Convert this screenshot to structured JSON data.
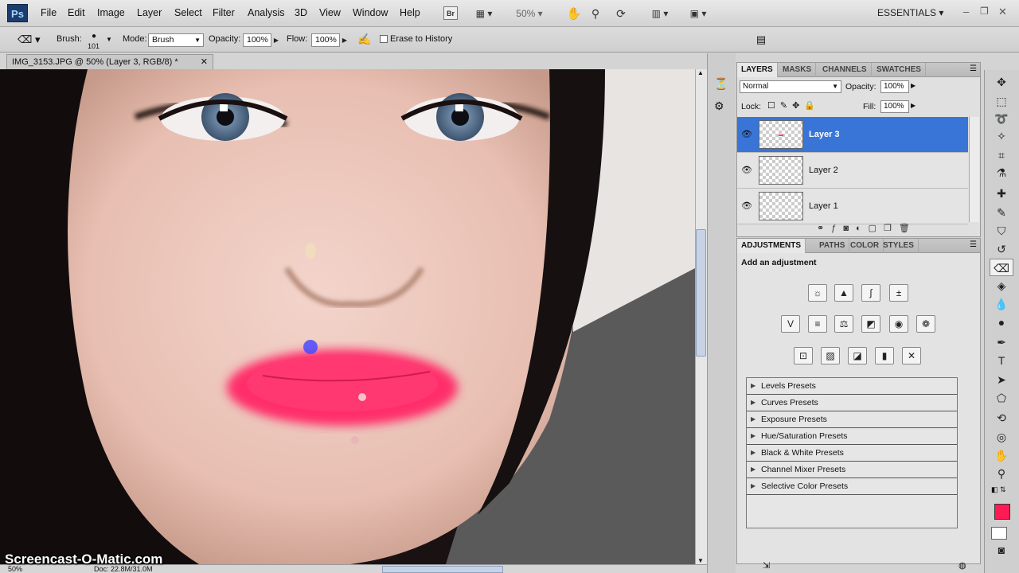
{
  "menubar": {
    "logo": "Ps",
    "items": [
      "File",
      "Edit",
      "Image",
      "Layer",
      "Select",
      "Filter",
      "Analysis",
      "3D",
      "View",
      "Window",
      "Help"
    ],
    "bridge": "Br",
    "zoom": "50%",
    "workspace": "ESSENTIALS"
  },
  "options": {
    "brush_label": "Brush:",
    "brush_size": "101",
    "mode_label": "Mode:",
    "mode_value": "Brush",
    "opacity_label": "Opacity:",
    "opacity_value": "100%",
    "flow_label": "Flow:",
    "flow_value": "100%",
    "erase_history": "Erase to History"
  },
  "document": {
    "tab_title": "IMG_3153.JPG @ 50% (Layer 3, RGB/8) *",
    "close": "✕"
  },
  "status": {
    "zoom": "50%",
    "doc": "Doc: 22.8M/31.0M"
  },
  "layers_panel": {
    "tabs": [
      "LAYERS",
      "MASKS",
      "CHANNELS",
      "SWATCHES"
    ],
    "blend_mode": "Normal",
    "opacity_label": "Opacity:",
    "opacity_value": "100%",
    "lock_label": "Lock:",
    "fill_label": "Fill:",
    "fill_value": "100%",
    "layers": [
      {
        "name": "Layer 3",
        "selected": true
      },
      {
        "name": "Layer 2",
        "selected": false
      },
      {
        "name": "Layer 1",
        "selected": false
      }
    ]
  },
  "adjustments_panel": {
    "tabs": [
      "ADJUSTMENTS",
      "PATHS",
      "COLOR",
      "STYLES"
    ],
    "heading": "Add an adjustment",
    "presets": [
      "Levels Presets",
      "Curves Presets",
      "Exposure Presets",
      "Hue/Saturation Presets",
      "Black & White Presets",
      "Channel Mixer Presets",
      "Selective Color Presets"
    ]
  },
  "colors": {
    "foreground": "#ff1a55",
    "background": "#ffffff",
    "selection": "#3875d7"
  },
  "watermark": "Screencast-O-Matic.com"
}
